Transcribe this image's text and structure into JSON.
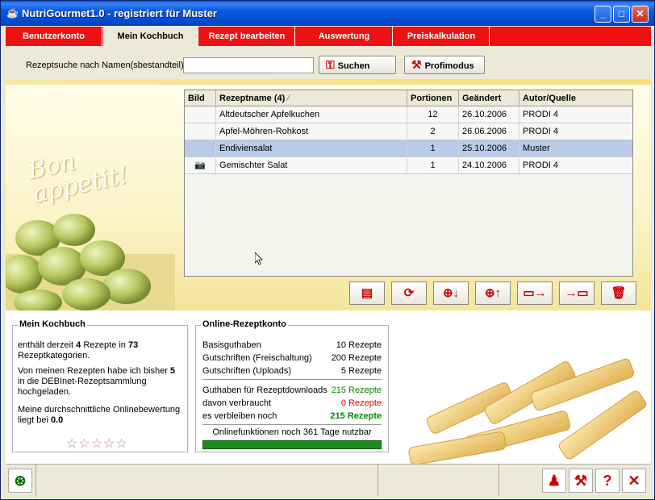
{
  "window": {
    "title": "NutriGourmet1.0 - registriert für Muster"
  },
  "tabs": [
    {
      "label": "Benutzerkonto"
    },
    {
      "label": "Mein Kochbuch"
    },
    {
      "label": "Rezept bearbeiten"
    },
    {
      "label": "Auswertung"
    },
    {
      "label": "Preiskalkulation"
    }
  ],
  "search": {
    "label": "Rezeptsuche nach Namen(sbestandteil):",
    "value": "",
    "search_button": "Suchen",
    "profi_button": "Profimodus"
  },
  "decor": {
    "bon_line1": "Bon",
    "bon_line2": "appetit!"
  },
  "table": {
    "headers": [
      "Bild",
      "Rezeptname (4)",
      "Portionen",
      "Geändert",
      "Autor/Quelle"
    ],
    "rows": [
      {
        "bild": "",
        "name": "Altdeutscher Apfelkuchen",
        "portionen": "12",
        "geaendert": "26.10.2006",
        "autor": "PRODI 4"
      },
      {
        "bild": "",
        "name": "Apfel-Möhren-Rohkost",
        "portionen": "2",
        "geaendert": "26.06.2006",
        "autor": "PRODI 4"
      },
      {
        "bild": "",
        "name": "Endiviensalat",
        "portionen": "1",
        "geaendert": "25.10.2006",
        "autor": "Muster"
      },
      {
        "bild": "camera-icon",
        "name": "Gemischter Salat",
        "portionen": "1",
        "geaendert": "24.10.2006",
        "autor": "PRODI 4"
      }
    ],
    "selected_row": 2
  },
  "kochbuch": {
    "title": "Mein Kochbuch",
    "line1_pre": "enthält derzeit ",
    "count": "4",
    "line1_mid": " Rezepte in ",
    "categories": "73",
    "line1_post": "Rezeptkategorien.",
    "line2_pre": "Von meinen Rezepten habe ich bisher ",
    "uploaded": "5",
    "line2_post1": "in die DEBInet-Rezeptsammlung",
    "line2_post2": "hochgeladen.",
    "line3_1": "Meine durchschnittliche Onlinebewertung",
    "line3_2": "liegt bei ",
    "rating": "0.0",
    "stars_value": 0,
    "stars_max": 5
  },
  "online": {
    "title": "Online-Rezeptkonto",
    "rows": [
      {
        "label": "Basisguthaben",
        "value": "10 Rezepte"
      },
      {
        "label": "Gutschriften (Freischaltung)",
        "value": "200 Rezepte"
      },
      {
        "label": "Gutschriften (Uploads)",
        "value": "5 Rezepte"
      },
      {
        "label": "Guthaben für Rezeptdownloads",
        "value": "215 Rezepte"
      },
      {
        "label": "davon verbraucht",
        "value": "0 Rezepte"
      },
      {
        "label": "es verbleiben noch",
        "value": "215 Rezepte"
      }
    ],
    "status": "Onlinefunktionen noch 361 Tage nutzbar",
    "progress": 1.0
  },
  "colors": {
    "accent": "#ee1111",
    "selected": "#b8cbe8",
    "green": "#008800",
    "red": "#dd0000"
  }
}
